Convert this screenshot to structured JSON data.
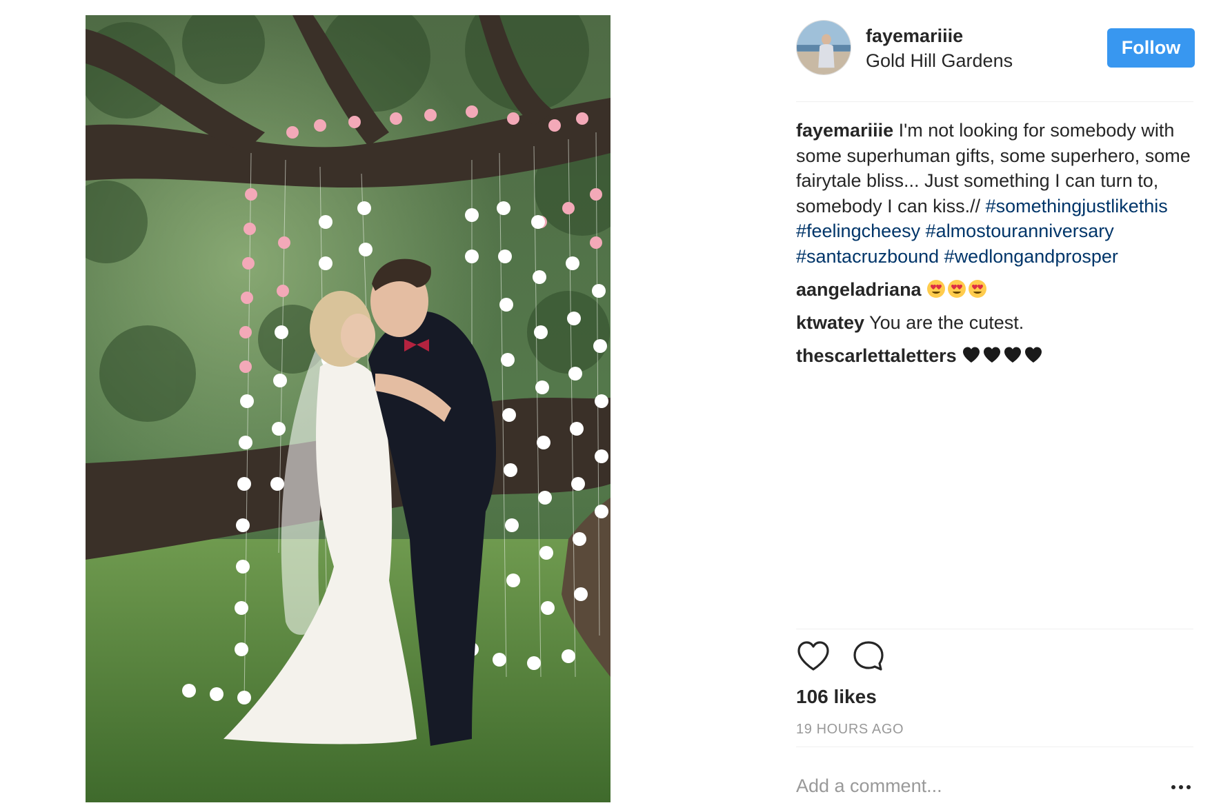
{
  "post": {
    "author": "fayemariiie",
    "location": "Gold Hill Gardens",
    "follow_label": "Follow",
    "caption": {
      "username": "fayemariiie",
      "text": " I'm not looking for somebody with some superhuman gifts, some superhero, some fairytale bliss... Just something I can turn to, somebody I can kiss.// ",
      "hashtags": [
        "#somethingjustlikethis",
        "#feelingcheesy",
        "#almostouranniversary",
        "#santacruzbound",
        "#wedlongandprosper"
      ]
    },
    "comments": [
      {
        "username": "aangeladriana",
        "text": "",
        "emoji": [
          "heart-eyes",
          "heart-eyes",
          "heart-eyes"
        ]
      },
      {
        "username": "ktwatey",
        "text": " You are the cutest.",
        "emoji": []
      },
      {
        "username": "thescarlettaletters",
        "text": "",
        "emoji": [
          "black-heart",
          "black-heart",
          "black-heart",
          "black-heart"
        ]
      }
    ],
    "likes": "106 likes",
    "timestamp": "19 HOURS AGO",
    "add_comment_placeholder": "Add a comment..."
  },
  "colors": {
    "follow_button": "#3897f0",
    "hashtag": "#003569",
    "muted_text": "#999999",
    "text": "#262626"
  },
  "icons": {
    "like": "heart-outline-icon",
    "comment": "speech-bubble-icon",
    "more": "ellipsis-icon"
  }
}
